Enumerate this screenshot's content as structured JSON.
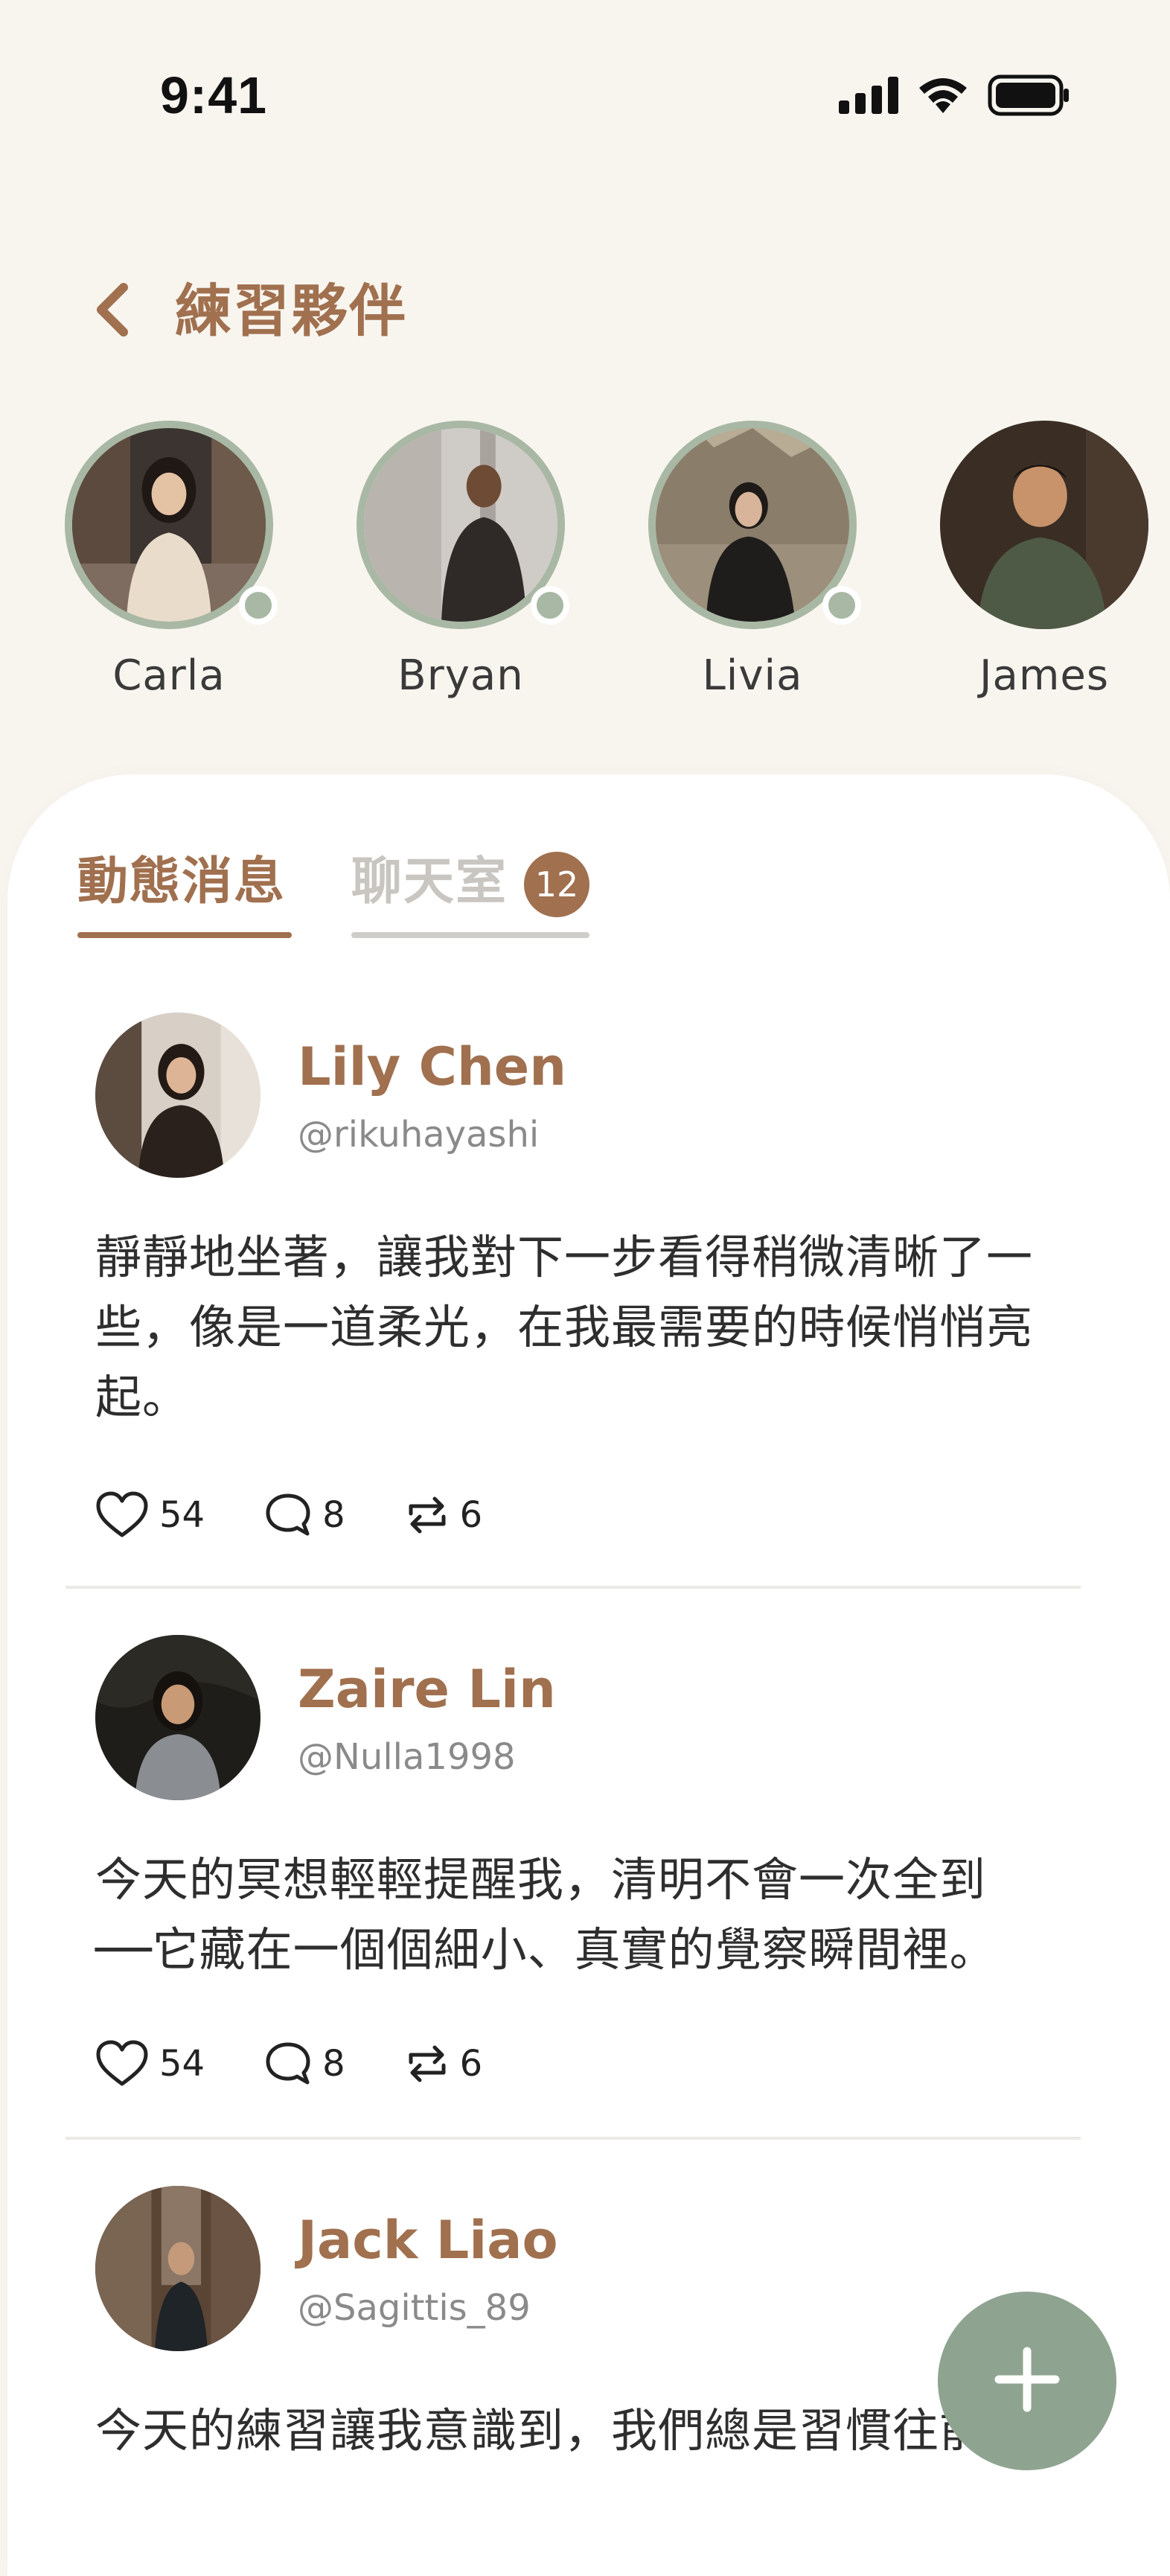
{
  "status_bar": {
    "time": "9:41"
  },
  "header": {
    "back_icon": "chevron-left-icon",
    "title": "練習夥伴"
  },
  "partners": [
    {
      "name": "Carla",
      "online": true
    },
    {
      "name": "Bryan",
      "online": true
    },
    {
      "name": "Livia",
      "online": true
    },
    {
      "name": "James",
      "online": false
    }
  ],
  "tabs": [
    {
      "label": "動態消息",
      "active": true
    },
    {
      "label": "聊天室",
      "active": false,
      "badge": "12"
    }
  ],
  "posts": [
    {
      "name": "Lily Chen",
      "handle": "@rikuhayashi",
      "body_lines": [
        "靜靜地坐著，讓我對下一步看得稍微清晰了一",
        "些，像是一道柔光，在我最需要的時候悄悄亮",
        "起。"
      ],
      "likes": "54",
      "comments": "8",
      "reposts": "6"
    },
    {
      "name": "Zaire Lin",
      "handle": "@Nulla1998",
      "body_lines": [
        "今天的冥想輕輕提醒我，清明不會一次全到",
        "──它藏在一個個細小、真實的覺察瞬間裡。"
      ],
      "likes": "54",
      "comments": "8",
      "reposts": "6"
    },
    {
      "name": "Jack Liao",
      "handle": "@Sagittis_89",
      "body_lines": [
        "今天的練習讓我意識到，我們總是習慣往前"
      ]
    }
  ],
  "icons": {
    "like": "heart-icon",
    "comment": "comment-bubble-icon",
    "repost": "repost-icon",
    "fab": "plus-icon"
  },
  "colors": {
    "accent": "#A0704F",
    "sage": "#A8B8A4",
    "fab": "#8EA491",
    "background": "#F8F5EF"
  }
}
